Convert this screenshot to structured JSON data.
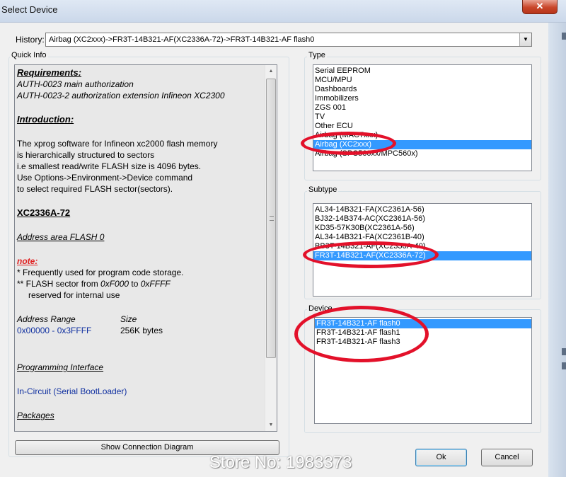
{
  "window": {
    "title": "Select Device",
    "close_glyph": "✕"
  },
  "history": {
    "label": "History:",
    "value": "Airbag (XC2xxx)->FR3T-14B321-AF(XC2336A-72)->FR3T-14B321-AF flash0"
  },
  "quick_info": {
    "caption": "Quick Info",
    "requirements_heading": "Requirements:",
    "requirement_1": "AUTH-0023  main authorization",
    "requirement_2": "AUTH-0023-2 authorization extension Infineon XC2300",
    "introduction_heading": "Introduction:",
    "intro_line_1": "The xprog software for Infineon xc2000 flash memory",
    "intro_line_2": "is hierarchically structured to sectors",
    "intro_line_3": "i.e smallest read/write FLASH size is 4096 bytes.",
    "intro_line_4": "Use Options->Environment->Device command",
    "intro_line_5": "to select required FLASH  sector(sectors).",
    "device_name": "XC2336A-72",
    "address_area": "Address area FLASH 0",
    "note_heading": "note:",
    "note_line_1": "* Frequently used for program code storage.",
    "note_line_2_prefix": "** FLASH sector from ",
    "note_line_2_from": "0xF000",
    "note_line_2_mid": " to ",
    "note_line_2_to": "0xFFFF",
    "note_line_3": "reserved for internal use",
    "address_range_label": "Address Range",
    "size_label": "Size",
    "address_range_value": "0x00000 - 0x3FFFF",
    "size_value": "256K bytes",
    "programming_interface_heading": "Programming Interface",
    "programming_interface_value": "In-Circuit (Serial BootLoader)",
    "packages_heading": "Packages"
  },
  "show_diagram_button": "Show Connection Diagram",
  "type_group": {
    "caption": "Type",
    "items": [
      "Serial EEPROM",
      "MCU/MPU",
      "Dashboards",
      "Immobilizers",
      "ZGS 001",
      "TV",
      "Other ECU",
      "Airbag (MAC7xxx)",
      "Airbag (XC2xxx)",
      "Airbag (SPC560xx/MPC560x)"
    ],
    "selected_index": 8
  },
  "subtype_group": {
    "caption": "Subtype",
    "items": [
      "AL34-14B321-FA(XC2361A-56)",
      "BJ32-14B374-AC(XC2361A-56)",
      "KD35-57K30B(XC2361A-56)",
      "AL34-14B321-FA(XC2361B-40)",
      "BB3T-14B321-AF(XC2336A-40)",
      "FR3T-14B321-AF(XC2336A-72)"
    ],
    "selected_index": 5
  },
  "device_group": {
    "caption": "Device",
    "items": [
      "FR3T-14B321-AF flash0",
      "FR3T-14B321-AF flash1",
      "FR3T-14B321-AF flash3"
    ],
    "selected_index": 0
  },
  "buttons": {
    "ok": "Ok",
    "cancel": "Cancel"
  },
  "watermark": "Store No: 1983373",
  "colors": {
    "selection": "#3399ff",
    "highlight_circle": "#e3112a",
    "link_blue": "#1030a0",
    "note_red": "#e02020"
  }
}
